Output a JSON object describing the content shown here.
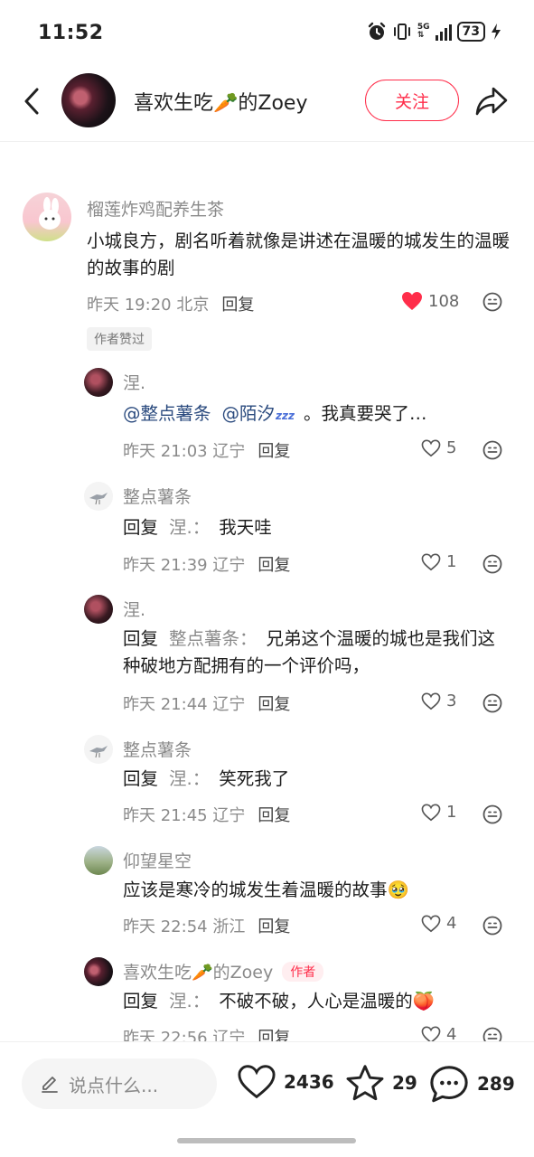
{
  "status_bar": {
    "time": "11:52",
    "battery": "73",
    "network": "5G"
  },
  "header": {
    "username": "喜欢生吃🥕的Zoey",
    "follow_label": "关注"
  },
  "top_comment": {
    "name": "榴莲炸鸡配养生茶",
    "text": "小城良方，剧名听着就像是讲述在温暖的城发生的温暖的故事的剧",
    "time": "昨天 19:20 北京",
    "reply_label": "回复",
    "likes": "108",
    "author_liked_badge": "作者赞过"
  },
  "replies": [
    {
      "name": "涅.",
      "mention1": "@整点薯条",
      "mention2": "@陌汐",
      "text": "。我真要哭了…",
      "time": "昨天 21:03 辽宁",
      "reply_label": "回复",
      "likes": "5"
    },
    {
      "name": "整点薯条",
      "reply_word": "回复",
      "reply_target": "涅.：",
      "text": "我天哇",
      "time": "昨天 21:39 辽宁",
      "reply_label": "回复",
      "likes": "1"
    },
    {
      "name": "涅.",
      "reply_word": "回复",
      "reply_target": "整点薯条：",
      "text": "兄弟这个温暖的城也是我们这种破地方配拥有的一个评价吗，",
      "time": "昨天 21:44 辽宁",
      "reply_label": "回复",
      "likes": "3"
    },
    {
      "name": "整点薯条",
      "reply_word": "回复",
      "reply_target": "涅.：",
      "text": "笑死我了",
      "time": "昨天 21:45 辽宁",
      "reply_label": "回复",
      "likes": "1"
    },
    {
      "name": "仰望星空",
      "text": "应该是寒冷的城发生着温暖的故事🥹",
      "time": "昨天 22:54 浙江",
      "reply_label": "回复",
      "likes": "4"
    },
    {
      "name": "喜欢生吃🥕的Zoey",
      "author_badge": "作者",
      "reply_word": "回复",
      "reply_target": "涅.：",
      "text": "不破不破，人心是温暖的🍑",
      "time": "昨天 22:56 辽宁",
      "reply_label": "回复",
      "likes": "4"
    }
  ],
  "bottom_bar": {
    "input_placeholder": "说点什么...",
    "likes": "2436",
    "stars": "29",
    "comments": "289"
  },
  "colors": {
    "accent": "#ff2d4a",
    "mention": "#2a4a7e",
    "muted": "#8a8a8a"
  }
}
